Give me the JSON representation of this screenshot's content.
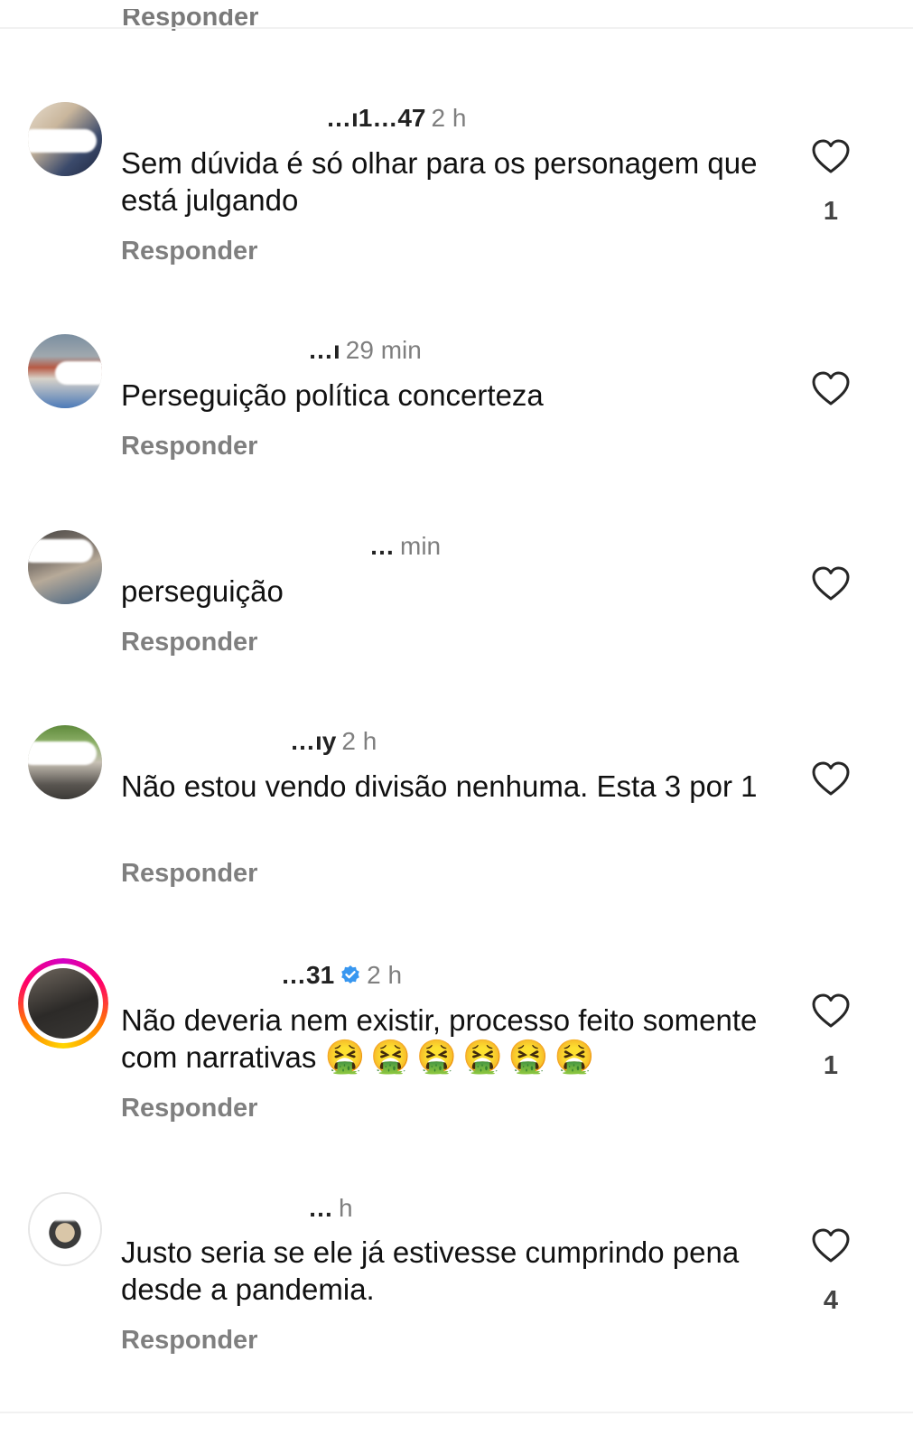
{
  "header": {
    "reply_label": "Responder"
  },
  "comments": [
    {
      "username": "…ı1…47",
      "time": "2 h",
      "text": "Sem dúvida é só olhar para os personagem que está julgando",
      "reply_label": "Responder",
      "likes": "1"
    },
    {
      "username": "…ı",
      "time": "29 min",
      "text": "Perseguição política concerteza",
      "reply_label": "Responder",
      "likes": ""
    },
    {
      "username": "…",
      "time": "min",
      "text": "perseguição",
      "reply_label": "Responder",
      "likes": ""
    },
    {
      "username": "…ıy",
      "time": "2 h",
      "text": "Não estou vendo divisão nenhuma. Esta 3 por 1",
      "reply_label": "Responder",
      "likes": ""
    },
    {
      "username": "…31",
      "time": "2 h",
      "text": "Não deveria nem existir, processo feito somente com narrativas",
      "emoji": "🤮🤮🤮🤮🤮🤮",
      "reply_label": "Responder",
      "likes": "1"
    },
    {
      "username": "…",
      "time": "h",
      "text": "Justo seria se ele já estivesse cumprindo pena desde a pandemia.",
      "reply_label": "Responder",
      "likes": "4"
    }
  ],
  "colors": {
    "verified": "#3897f0",
    "story_ring": "#ff0069"
  }
}
